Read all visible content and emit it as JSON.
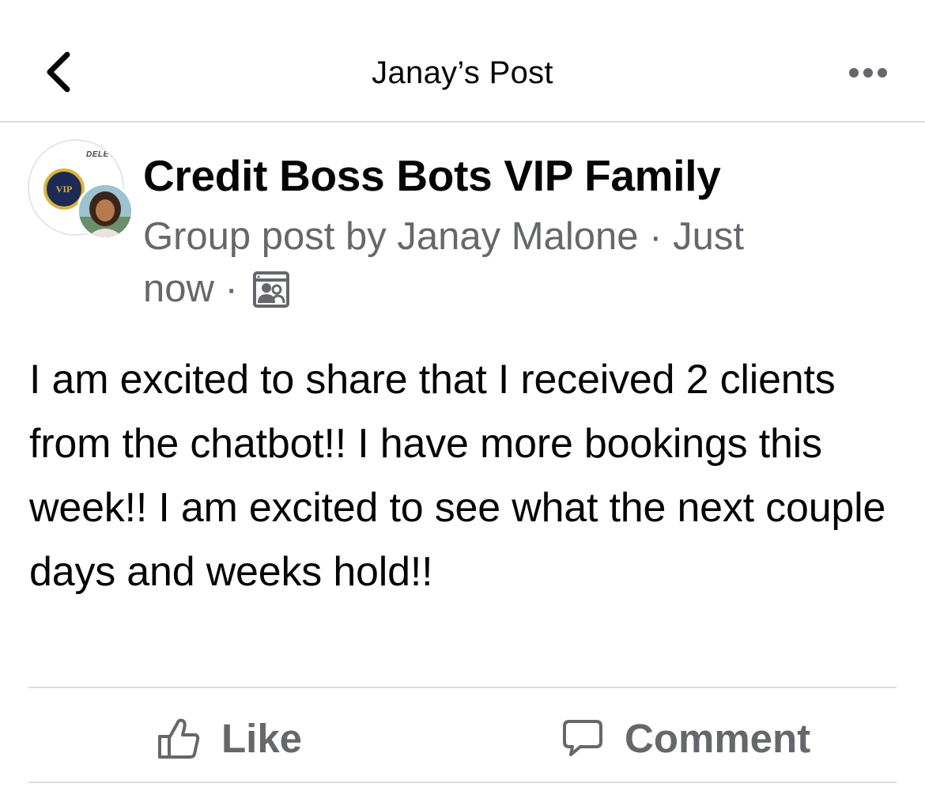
{
  "nav": {
    "title": "Janay’s Post",
    "back_icon": "chevron-left-icon",
    "more_icon": "more-horizontal-icon"
  },
  "post": {
    "group_name": "Credit Boss Bots VIP Family",
    "group_post_by": "Group post by",
    "author": "Janay Malone",
    "separator": "·",
    "time_line1": "Just",
    "time_line2": "now",
    "privacy_icon": "group-members-icon",
    "avatar_badge_text": "VIP",
    "avatar_label_text": "DELE",
    "body": "I am excited to share that I received 2 clients from the chatbot!! I have more bookings this week!! I am excited to see what the next couple days and weeks hold!!"
  },
  "actions": {
    "like_label": "Like",
    "comment_label": "Comment",
    "like_icon": "thumbs-up-icon",
    "comment_icon": "comment-bubble-icon"
  },
  "colors": {
    "text_primary": "#050505",
    "text_secondary": "#65676b",
    "divider": "#dadde1"
  }
}
